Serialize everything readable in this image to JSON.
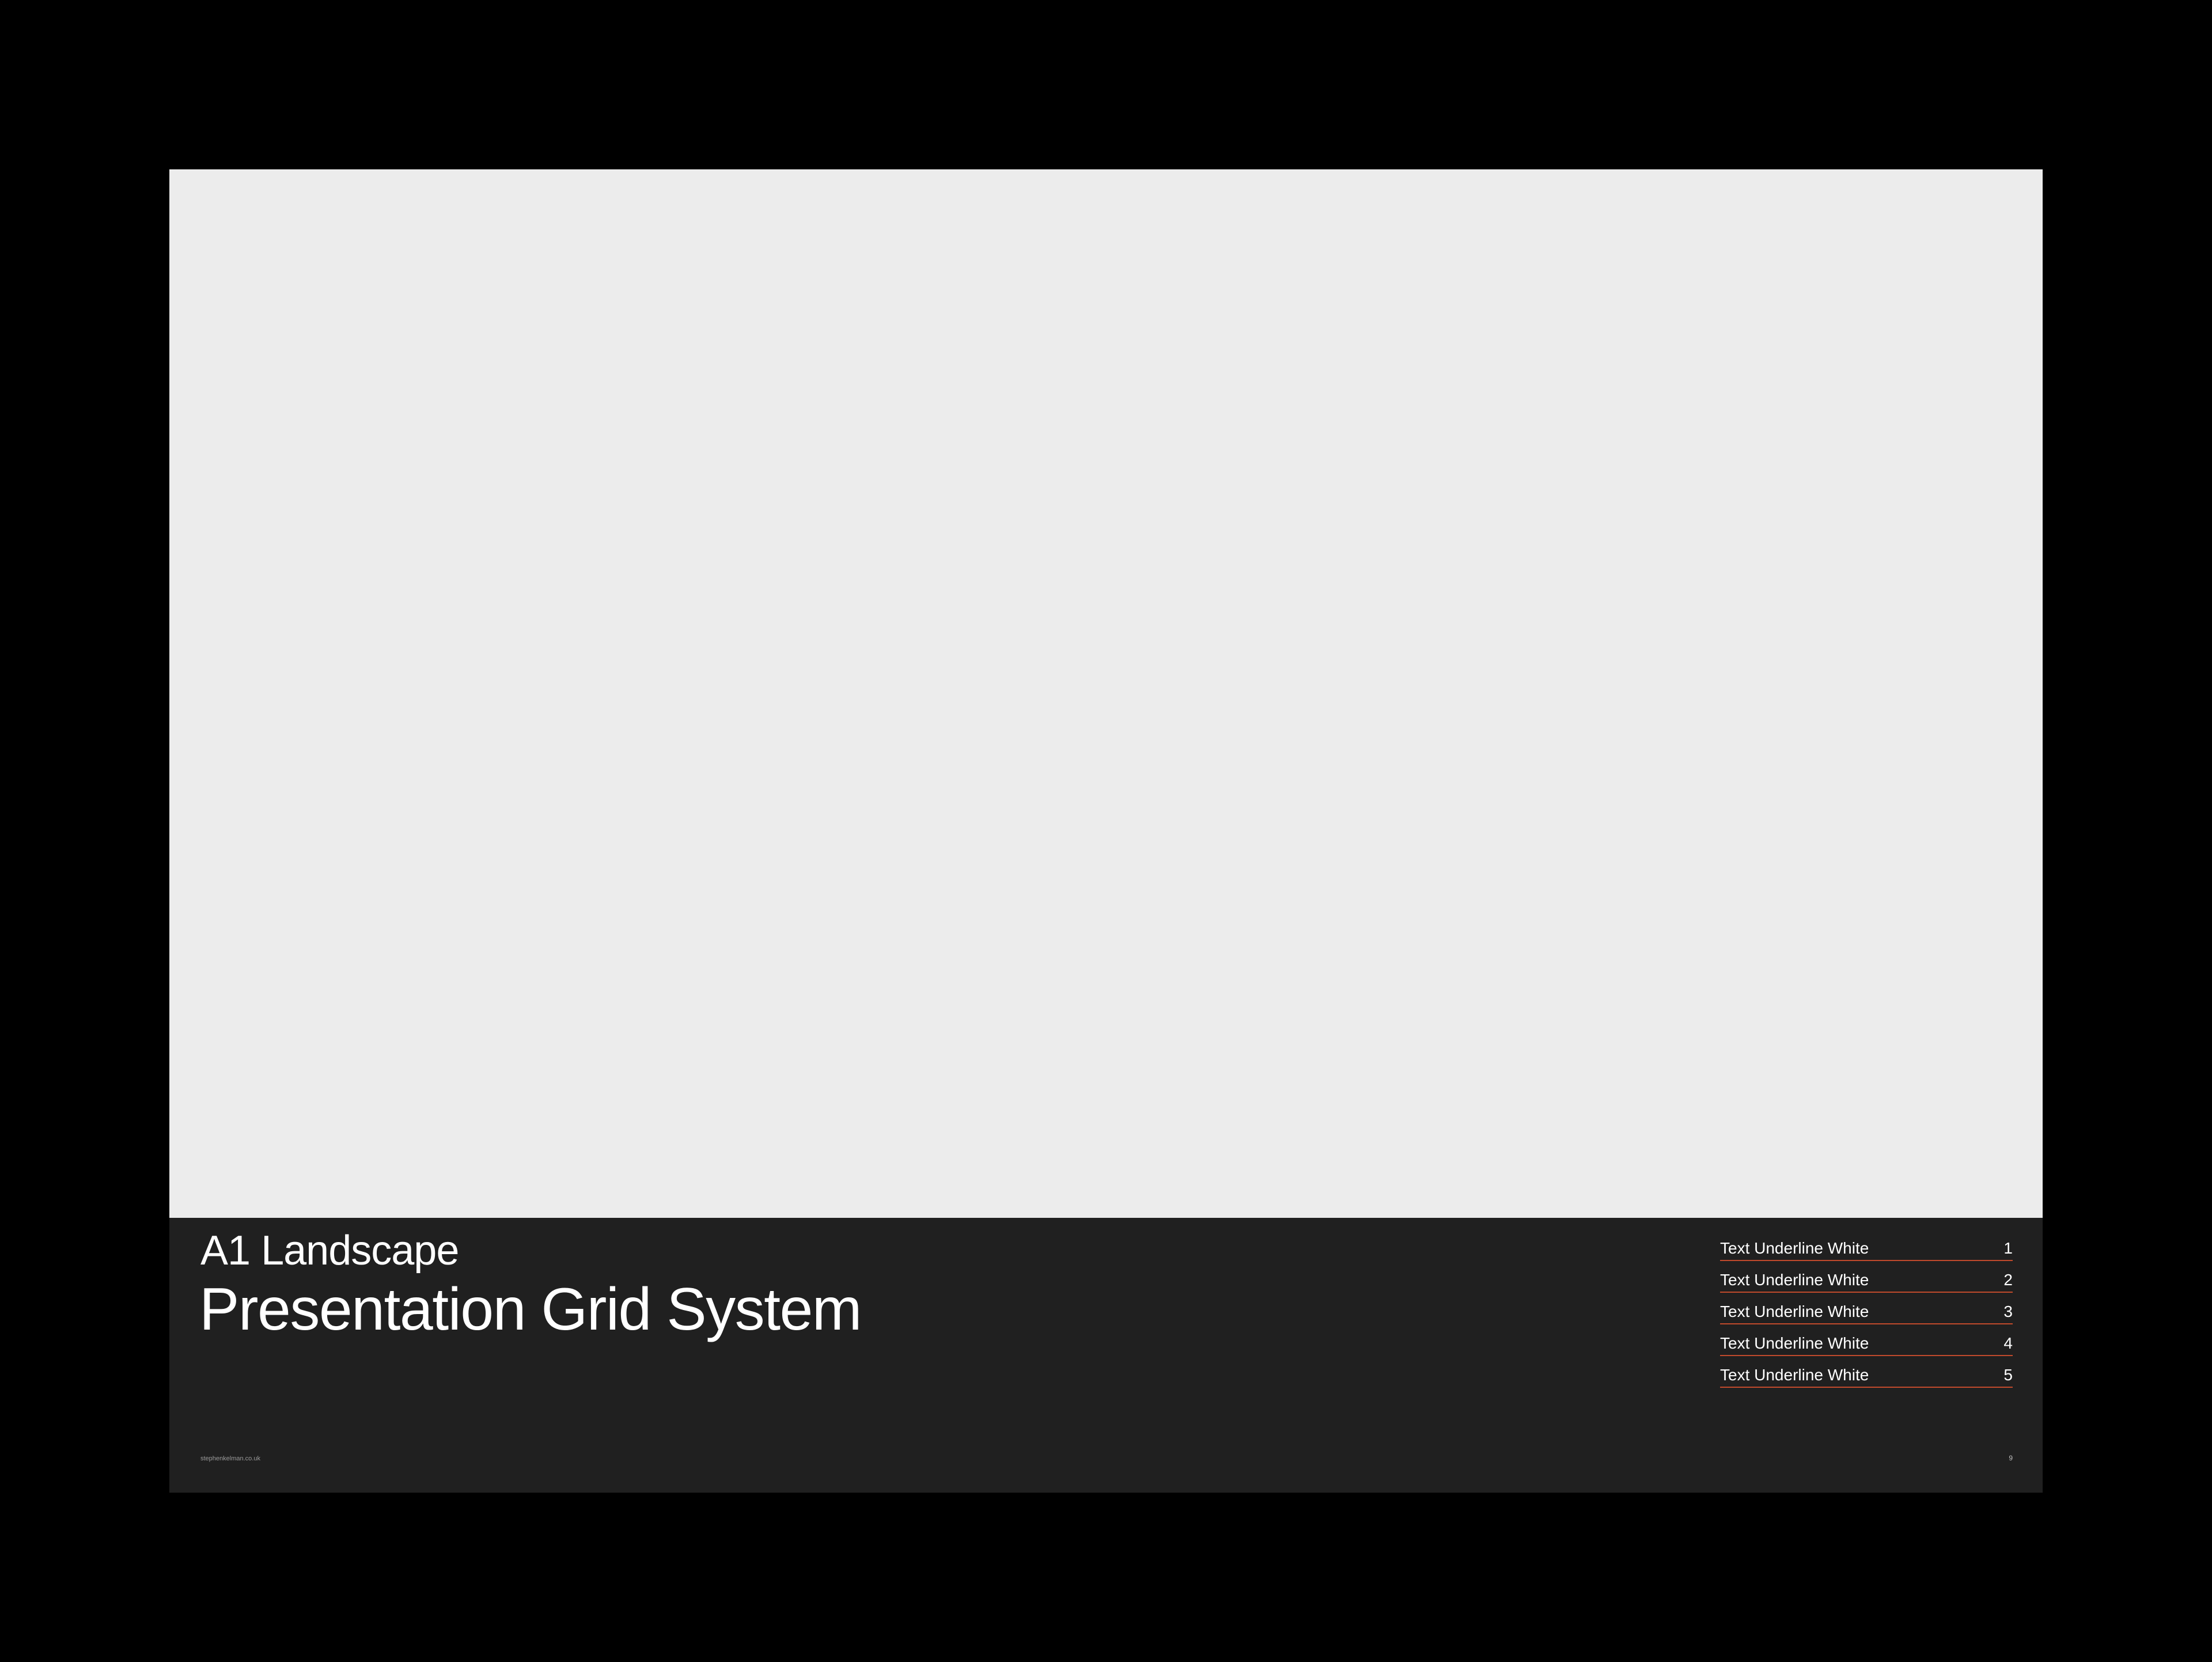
{
  "header": {
    "subtitle": "A1 Landscape",
    "title": "Presentation Grid System"
  },
  "index": {
    "items": [
      {
        "label": "Text Underline White",
        "number": "1"
      },
      {
        "label": "Text Underline White",
        "number": "2"
      },
      {
        "label": "Text Underline White",
        "number": "3"
      },
      {
        "label": "Text Underline White",
        "number": "4"
      },
      {
        "label": "Text Underline White",
        "number": "5"
      }
    ]
  },
  "footer": {
    "site": "stephenkelman.co.uk",
    "page_number": "9"
  },
  "colors": {
    "background": "#000000",
    "panel": "#202020",
    "placeholder": "#ececec",
    "underline_accent": "#c04a2c",
    "text": "#ffffff"
  }
}
